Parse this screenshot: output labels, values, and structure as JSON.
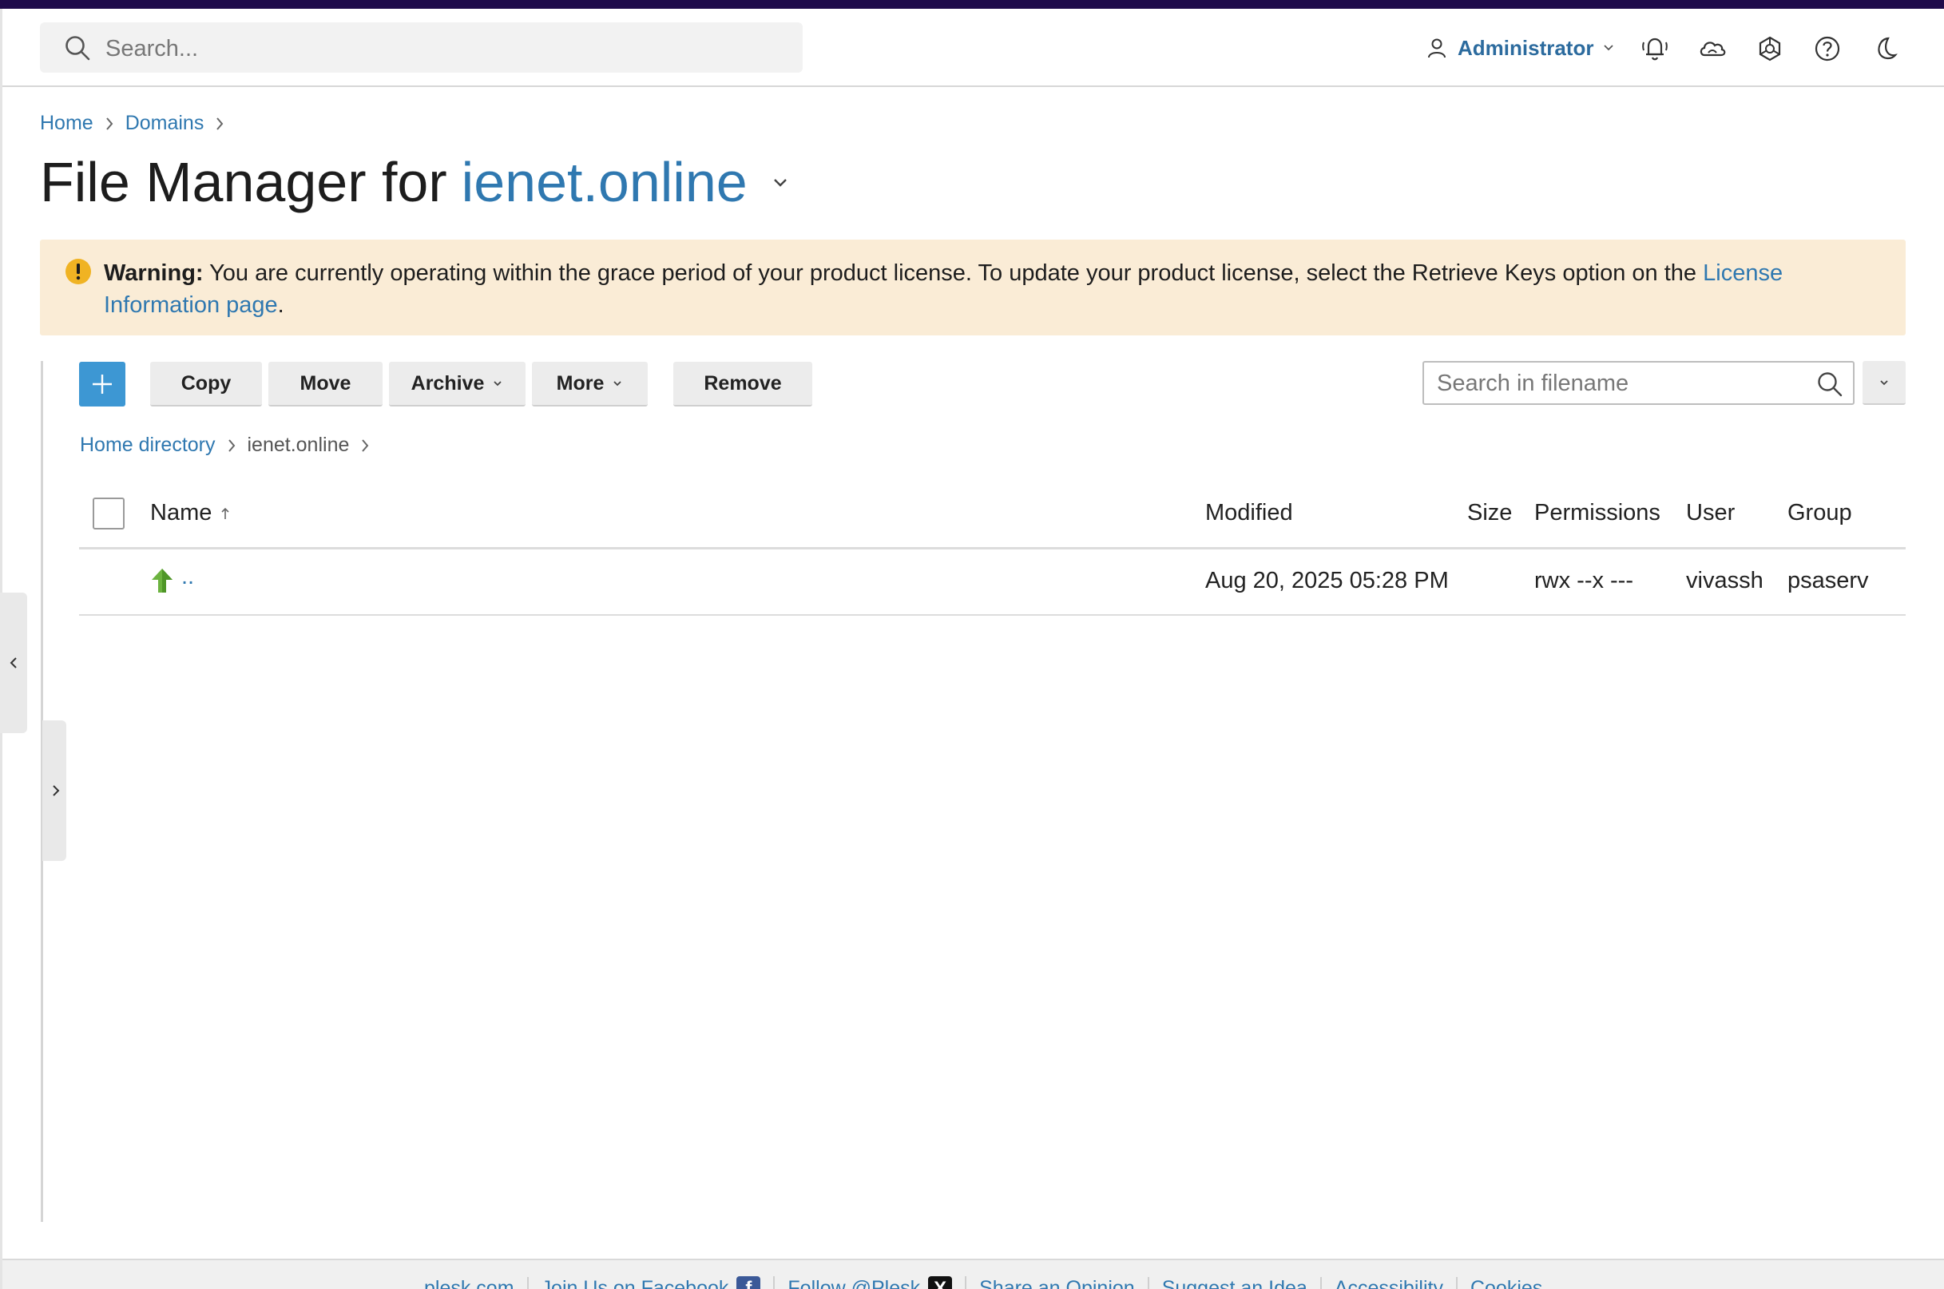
{
  "header": {
    "search_placeholder": "Search...",
    "user_label": "Administrator",
    "icons": [
      "notifications-icon",
      "cloud-icon",
      "extensions-icon",
      "help-icon",
      "dark-mode-icon"
    ]
  },
  "breadcrumb": {
    "items": [
      "Home",
      "Domains"
    ]
  },
  "page": {
    "title_prefix": "File Manager for",
    "domain": "ienet.online"
  },
  "warning": {
    "label": "Warning:",
    "message": " You are currently operating within the grace period of your product license. To update your product license, select the Retrieve Keys option on the ",
    "link_text": "License Information page",
    "suffix": "."
  },
  "toolbar": {
    "copy_label": "Copy",
    "move_label": "Move",
    "archive_label": "Archive",
    "more_label": "More",
    "remove_label": "Remove",
    "search_placeholder": "Search in filename"
  },
  "directory": {
    "root": "Home directory",
    "current": "ienet.online"
  },
  "table": {
    "columns": {
      "name": "Name",
      "modified": "Modified",
      "size": "Size",
      "permissions": "Permissions",
      "user": "User",
      "group": "Group"
    },
    "rows": [
      {
        "name": "..",
        "modified": "Aug 20, 2025 05:28 PM",
        "size": "",
        "permissions": "rwx --x ---",
        "user": "vivassh",
        "group": "psaserv"
      }
    ]
  },
  "footer": {
    "links": [
      "plesk.com",
      "Join Us on Facebook",
      "Follow @Plesk",
      "Share an Opinion",
      "Suggest an Idea",
      "Accessibility",
      "Cookies"
    ]
  },
  "colors": {
    "accent": "#2f78b0",
    "add_button": "#3d97d3",
    "warning_bg": "#faecd6",
    "warning_icon": "#f0b323",
    "top_strip": "#1e0b4a"
  }
}
